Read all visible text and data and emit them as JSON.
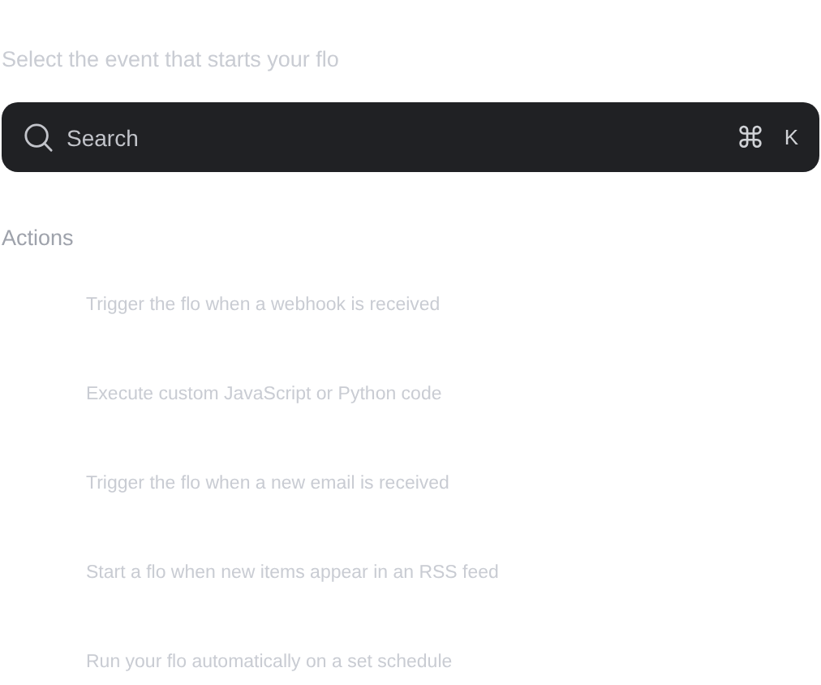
{
  "subtitle": "Select the event that starts your flo",
  "search": {
    "placeholder": "Search",
    "shortcut_symbol": "⌘",
    "shortcut_key": "K"
  },
  "section": {
    "title": "Actions"
  },
  "actions": [
    {
      "description": "Trigger the flo when a webhook is received"
    },
    {
      "description": "Execute custom JavaScript or Python code"
    },
    {
      "description": "Trigger the flo when a new email is received"
    },
    {
      "description": "Start a flo when new items appear in an RSS feed"
    },
    {
      "description": "Run your flo automatically on a set schedule"
    }
  ]
}
